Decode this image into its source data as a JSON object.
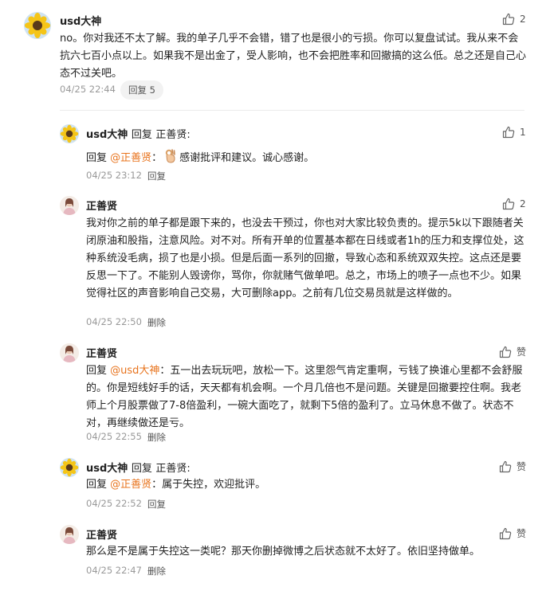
{
  "main_comment": {
    "author": "usd大神",
    "likes": "2",
    "text": "no。你对我还不太了解。我的单子几乎不会错，错了也是很小的亏损。你可以复盘试试。我从来不会抗六七百小点以上。如果我不是出金了，受人影响，也不会把胜率和回撤搞的这么低。总之还是自己心态不过关吧。",
    "time": "04/25 22:44",
    "reply_label": "回复 5"
  },
  "replies": [
    {
      "author": "usd大神",
      "reply_word": "回复",
      "target": "正善贤:",
      "likes": "1",
      "prefix": "回复 ",
      "mention": "@正善贤",
      "after_mention": "：",
      "emoji": "ok-hand-icon",
      "text": "感谢批评和建议。诚心感谢。",
      "time": "04/25 23:12",
      "action": "回复"
    },
    {
      "author": "正善贤",
      "likes": "2",
      "text": "我对你之前的单子都是跟下来的，也没去干预过，你也对大家比较负责的。提示5k以下跟随者关闭原油和股指，注意风险。对不对。所有开单的位置基本都在日线或者1h的压力和支撑位处，这种系统没毛病，损了也是小损。但是后面一系列的回撤，导致心态和系统双双失控。这点还是要反思一下了。不能别人毁谤你，骂你，你就赌气做单吧。总之，市场上的喷子一点也不少。如果觉得社区的声音影响自己交易，大可删除app。之前有几位交易员就是这样做的。",
      "time": "04/25 22:50",
      "action": "删除"
    },
    {
      "author": "正善贤",
      "likes": "赞",
      "prefix": "回复 ",
      "mention": "@usd大神",
      "after_mention": "：",
      "text": "五一出去玩玩吧，放松一下。这里怨气肯定重啊，亏钱了换谁心里都不会舒服的。你是短线好手的话，天天都有机会啊。一个月几倍也不是问题。关键是回撤要控住啊。我老师上个月股票做了7-8倍盈利，一碗大面吃了，就剩下5倍的盈利了。立马休息不做了。状态不对，再继续做还是亏。",
      "time": "04/25 22:55",
      "action": "删除"
    },
    {
      "author": "usd大神",
      "reply_word": "回复",
      "target": "正善贤:",
      "likes": "赞",
      "prefix": "回复 ",
      "mention": "@正善贤",
      "after_mention": "：",
      "text": "属于失控，欢迎批评。",
      "time": "04/25 22:52",
      "action": "回复"
    },
    {
      "author": "正善贤",
      "likes": "赞",
      "text": "那么是不是属于失控这一类呢？那天你删掉微博之后状态就不太好了。依旧坚持做单。",
      "time": "04/25 22:47",
      "action": "删除"
    }
  ]
}
